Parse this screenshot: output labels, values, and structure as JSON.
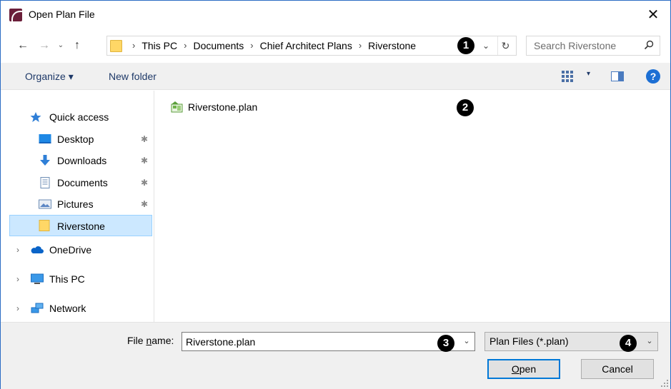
{
  "window": {
    "title": "Open Plan File",
    "close_glyph": "✕"
  },
  "nav": {
    "back_glyph": "←",
    "forward_glyph": "→",
    "recent_glyph": "⌄",
    "up_glyph": "↑"
  },
  "address": {
    "crumbs": [
      "This PC",
      "Documents",
      "Chief Architect Plans",
      "Riverstone"
    ],
    "separator": "›",
    "dropdown_glyph": "⌄",
    "refresh_glyph": "↻"
  },
  "search": {
    "placeholder": "Search Riverstone"
  },
  "toolbar": {
    "organize_label": "Organize ▾",
    "new_folder_label": "New folder",
    "view_arrow": "▾",
    "help_glyph": "?"
  },
  "sidebar": {
    "items": [
      {
        "label": "Quick access",
        "icon": "star-icon",
        "pinned": false
      },
      {
        "label": "Desktop",
        "icon": "desktop-icon",
        "pinned": true
      },
      {
        "label": "Downloads",
        "icon": "download-icon",
        "pinned": true
      },
      {
        "label": "Documents",
        "icon": "documents-icon",
        "pinned": true
      },
      {
        "label": "Pictures",
        "icon": "pictures-icon",
        "pinned": true
      },
      {
        "label": "Riverstone",
        "icon": "folder-icon",
        "pinned": false,
        "selected": true
      },
      {
        "label": "OneDrive",
        "icon": "cloud-icon",
        "pinned": false
      },
      {
        "label": "This PC",
        "icon": "computer-icon",
        "pinned": false
      },
      {
        "label": "Network",
        "icon": "network-icon",
        "pinned": false
      }
    ],
    "pin_glyph": "📌",
    "expander_glyph": "›"
  },
  "files": [
    {
      "name": "Riverstone.plan",
      "icon": "plan-file-icon"
    }
  ],
  "callouts": [
    "1",
    "2",
    "3",
    "4"
  ],
  "bottom": {
    "filename_label_pre": "File ",
    "filename_label_accel": "n",
    "filename_label_post": "ame:",
    "filename_value": "Riverstone.plan",
    "filetype_value": "Plan Files (*.plan)",
    "dropdown_glyph": "⌄",
    "open_accel": "O",
    "open_rest": "pen",
    "cancel_label": "Cancel"
  },
  "colors": {
    "accent": "#0078d7",
    "selection": "#cce8ff",
    "toolbar_bg": "#f0f0f0",
    "folder": "#ffd766"
  }
}
